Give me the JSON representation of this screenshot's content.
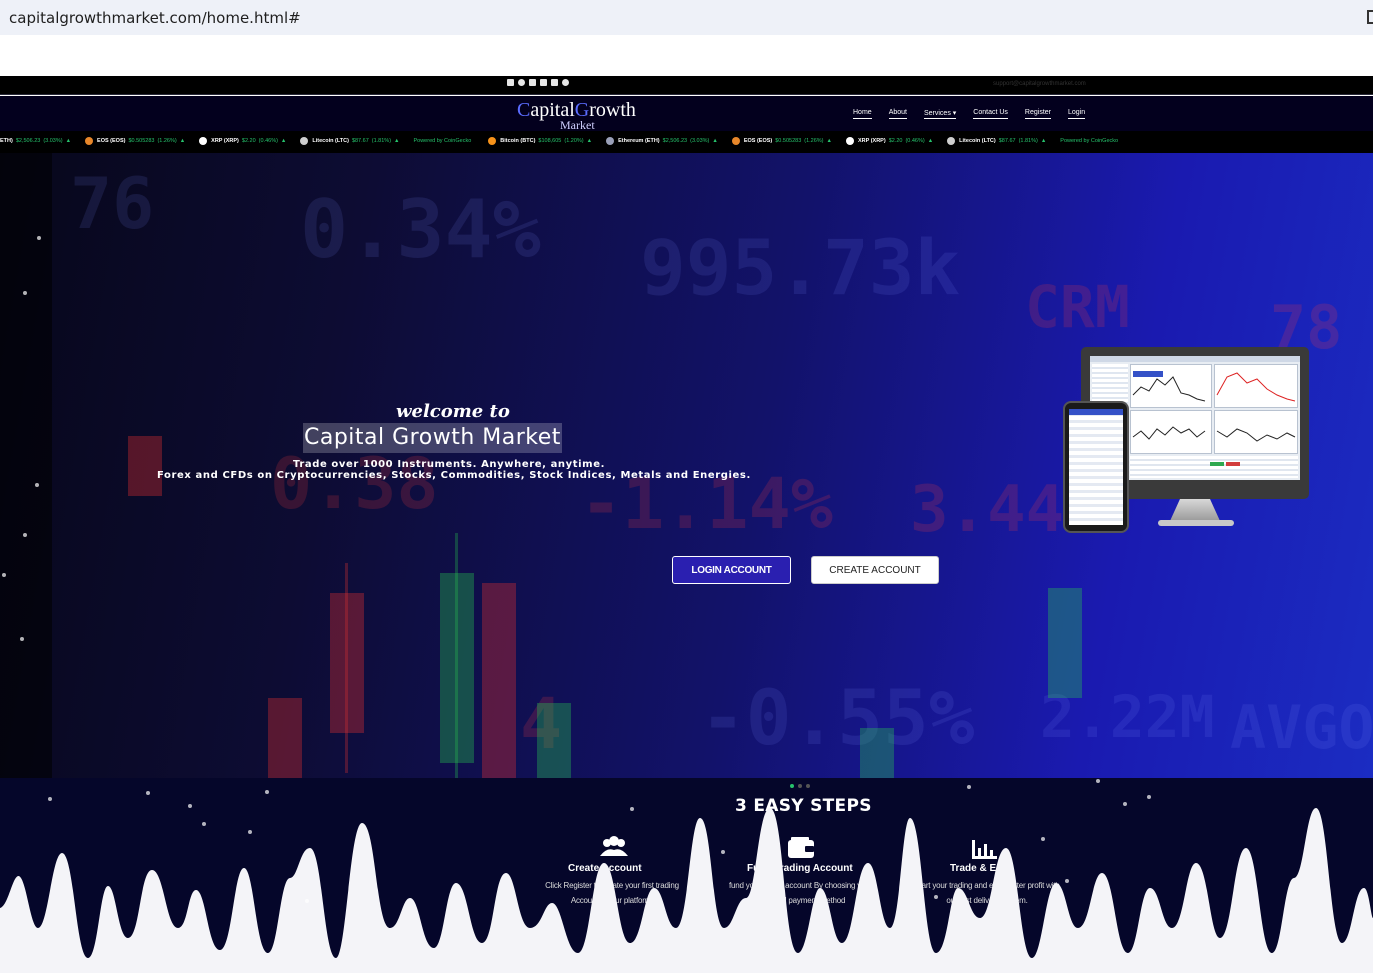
{
  "browser": {
    "url": "capitalgrowthmarket.com/home.html#"
  },
  "topbar": {
    "email": "support@capitalgrowthmarket.com",
    "social_icons": [
      "twitter-icon",
      "facebook-icon",
      "instagram-icon",
      "linkedin-icon",
      "mail-icon",
      "telegram-icon"
    ]
  },
  "header": {
    "logo_c": "C",
    "logo_apital": "apital",
    "logo_g": "G",
    "logo_rowth": "rowth",
    "logo_sub": "Market",
    "nav": [
      "Home",
      "About",
      "Services ▾",
      "Contact Us",
      "Register",
      "Login"
    ]
  },
  "ticker": {
    "items": [
      {
        "name": "ETH)",
        "price": "$2,506.23",
        "change": "(3.03%)",
        "arrow": "▲",
        "coin": ""
      },
      {
        "name": "EOS (EOS)",
        "price": "$0.505283",
        "change": "(1.26%)",
        "arrow": "▲",
        "coin": "#e8872a"
      },
      {
        "name": "XRP (XRP)",
        "price": "$2.20",
        "change": "(0.46%)",
        "arrow": "▲",
        "coin": "#ffffff"
      },
      {
        "name": "Litecoin (LTC)",
        "price": "$87.67",
        "change": "(1.81%)",
        "arrow": "▲",
        "coin": "#cfcfcf"
      },
      {
        "name": "Powered by CoinGecko",
        "price": "",
        "change": "",
        "arrow": "",
        "coin": "",
        "powered": true
      },
      {
        "name": "Bitcoin (BTC)",
        "price": "$108,605",
        "change": "(1.20%)",
        "arrow": "▲",
        "coin": "#f7931a"
      },
      {
        "name": "Ethereum (ETH)",
        "price": "$2,506.23",
        "change": "(3.03%)",
        "arrow": "▲",
        "coin": "#9aa0b8"
      },
      {
        "name": "EOS (EOS)",
        "price": "$0.505283",
        "change": "(1.26%)",
        "arrow": "▲",
        "coin": "#e8872a"
      },
      {
        "name": "XRP (XRP)",
        "price": "$2.20",
        "change": "(0.46%)",
        "arrow": "▲",
        "coin": "#ffffff"
      },
      {
        "name": "Litecoin (LTC)",
        "price": "$87.67",
        "change": "(1.81%)",
        "arrow": "▲",
        "coin": "#cfcfcf"
      },
      {
        "name": "Powered by CoinGecko",
        "price": "",
        "change": "",
        "arrow": "",
        "coin": "",
        "powered": true
      }
    ]
  },
  "hero": {
    "welcome": "welcome to",
    "title": "Capital Growth Market",
    "subtitle1": "Trade over 1000 Instruments. Anywhere, anytime.",
    "subtitle2": "Forex and CFDs on Cryptocurrencies, Stocks, Commodities, Stock Indices, Metals and Energies.",
    "login_button": "LOGIN ACCOUNT",
    "create_button": "CREATE ACCOUNT",
    "bg_numbers": [
      "76",
      "0.34%",
      "995.73k",
      "CRM",
      "78",
      "0.38",
      "-1.14%",
      "3.44",
      "-0.55%",
      "2.22M",
      "AVGO",
      "4"
    ]
  },
  "steps": {
    "title": "3 EASY STEPS",
    "items": [
      {
        "title": "Create Account",
        "line1": "Click Register to create your first trading",
        "line2": "Account on our platform.",
        "icon": "users-icon"
      },
      {
        "title": "Fund Trading Account",
        "line1": "fund you trading account By choosing your",
        "line2": "preferred payment method",
        "icon": "wallet-icon"
      },
      {
        "title": "Trade & Earn",
        "line1": "Start your trading and earn better profit with",
        "line2": "our fast delivery system.",
        "icon": "bar-chart-icon"
      }
    ]
  },
  "colors": {
    "header_bg": "#03001e",
    "login_button_bg": "#2a1fb0",
    "ticker_green": "#26c26c",
    "steps_bg": "#05062a"
  }
}
